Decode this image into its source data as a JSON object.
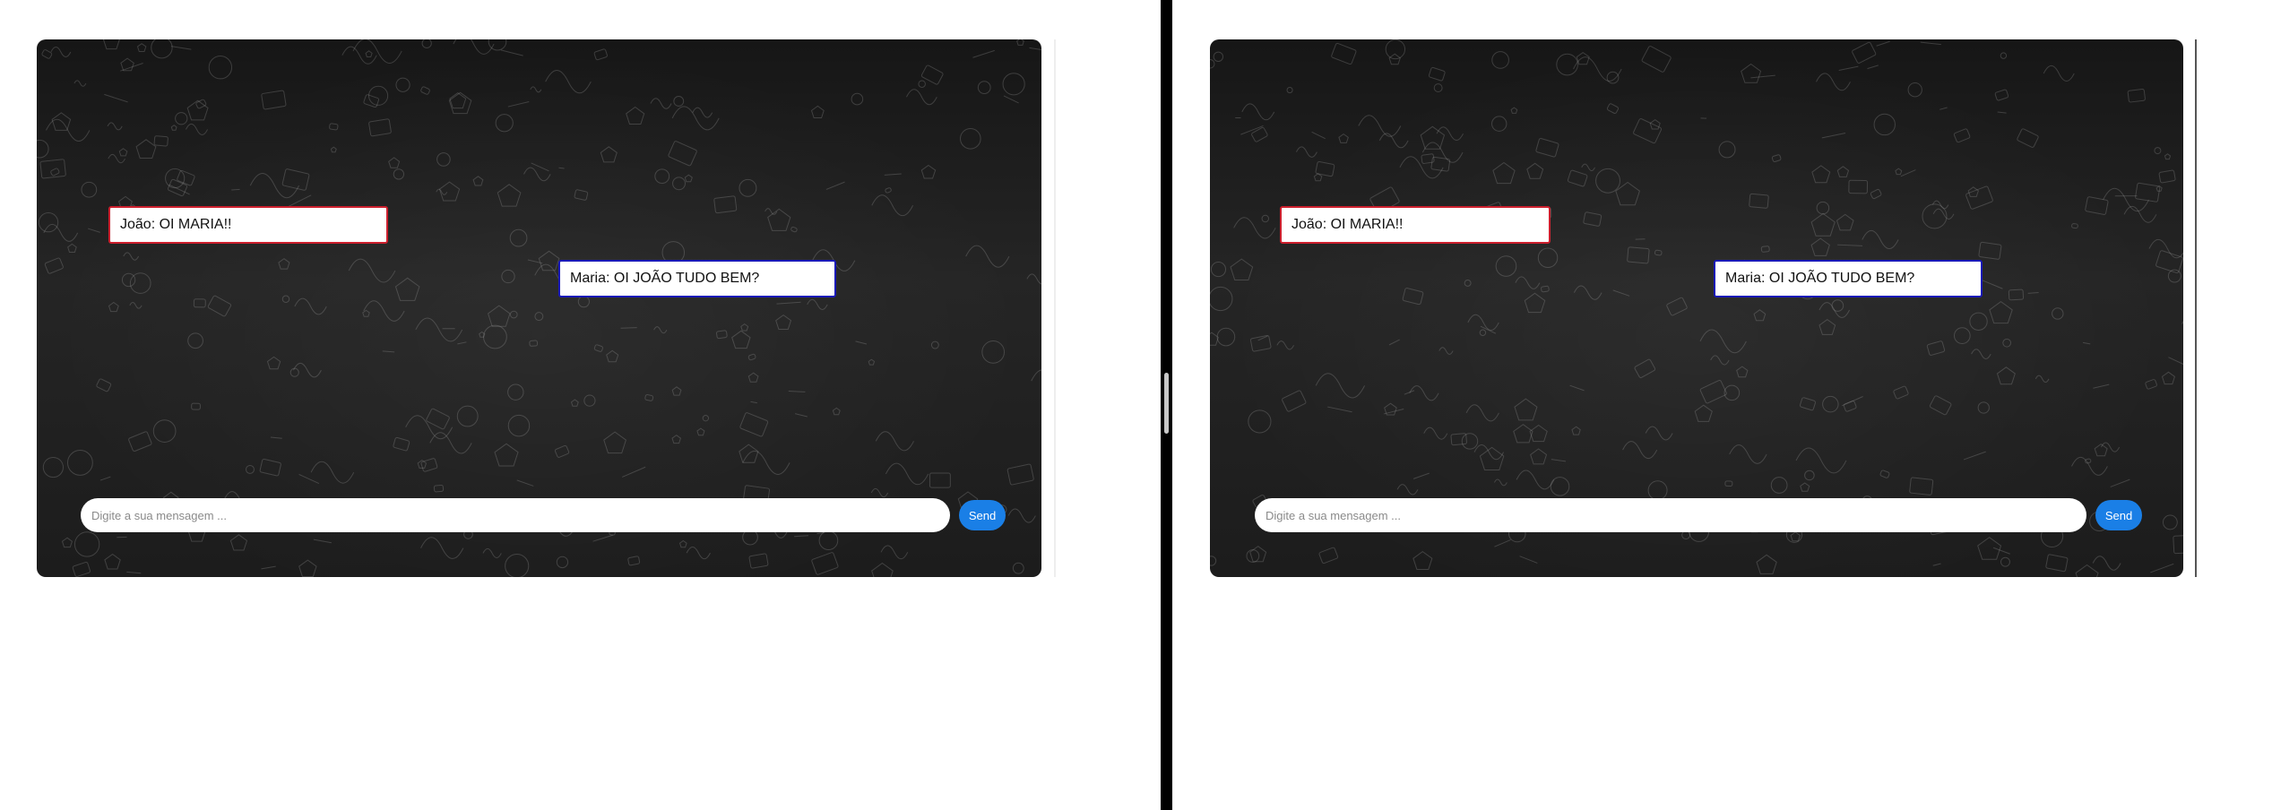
{
  "chat": {
    "messages": [
      {
        "author": "João",
        "text": "João: OI MARIA!!"
      },
      {
        "author": "Maria",
        "text": "Maria: OI JOÃO TUDO BEM?"
      }
    ],
    "input": {
      "placeholder": "Digite a sua mensagem ...",
      "value": ""
    },
    "send_label": "Send"
  },
  "colors": {
    "joao_border": "#cc1f2d",
    "maria_border": "#1a1ab8",
    "send_button": "#1a7fe6",
    "chat_background": "#1f1f1f"
  },
  "icons": {
    "divider_grip": "resize-handle-icon",
    "background": "doodle-pattern"
  }
}
